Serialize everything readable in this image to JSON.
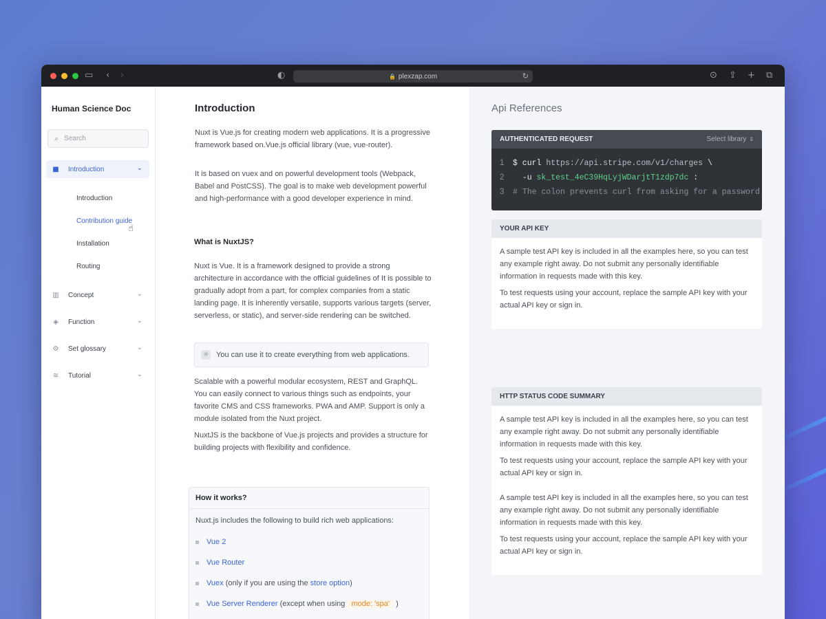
{
  "browser": {
    "url": "plexzap.com",
    "traffic_colors": [
      "#ff5f57",
      "#febc2e",
      "#28c840"
    ]
  },
  "sidebar": {
    "brand": "Human Science Doc",
    "search_placeholder": "Search",
    "sections": [
      {
        "label": "Introduction",
        "icon": "briefcase-icon",
        "expanded": true,
        "children": [
          "Introduction",
          "Contribution guide",
          "Installation",
          "Routing"
        ]
      },
      {
        "label": "Concept",
        "icon": "bar-chart-icon"
      },
      {
        "label": "Function",
        "icon": "layers-icon"
      },
      {
        "label": "Set glossary",
        "icon": "gear-icon"
      },
      {
        "label": "Tutorial",
        "icon": "stack-icon"
      }
    ],
    "active_child": "Contribution guide"
  },
  "main": {
    "title": "Introduction",
    "intro_p1": "Nuxt is Vue.js for creating modern web applications. It is a progressive framework based on.Vue.js official library (vue, vue-router).",
    "intro_p2": "It is based on vuex and on powerful development tools (Webpack, Babel and PostCSS). The goal is to make web development powerful and high-performance with a good developer experience in mind.",
    "what_title": "What is NuxtJS?",
    "what_p1": "Nuxt is Vue. It is a framework designed to provide a strong architecture in accordance with the official guidelines of It is possible to gradually adopt from a part, for complex companies from a static landing page. It is inherently versatile, supports various targets (server, serverless, or static), and server-side rendering can be switched.",
    "tip": "You can use it to create everything from web applications.",
    "scal_p1": "Scalable with a powerful modular ecosystem, REST and GraphQL. You can easily connect to various things such as endpoints, your favorite CMS and CSS frameworks. PWA and AMP. Support is only a module isolated from the Nuxt project.",
    "scal_p2": "NuxtJS is the backbone of Vue.js projects and provides a structure for building projects with flexibility and confidence.",
    "how": {
      "title": "How it works?",
      "intro": "Nuxt.js includes the following to build rich web applications:",
      "items": [
        {
          "link": "Vue 2",
          "rest": ""
        },
        {
          "link": "Vue Router",
          "rest": ""
        },
        {
          "link": "Vuex",
          "rest_before": " (only if you are using the ",
          "link2": "store option",
          "rest_after": ")"
        },
        {
          "link": "Vue Server Renderer",
          "rest_before": " (except when using ",
          "code": "mode: 'spa'",
          "rest_after": " )"
        }
      ]
    }
  },
  "right": {
    "title": "Api References",
    "request": {
      "header": "AUTHENTICATED REQUEST",
      "select_label": "Select library",
      "lines": [
        {
          "num": "1",
          "prefix": "$ curl ",
          "url": "https://api.stripe.com/v1/charges",
          "suffix": " \\"
        },
        {
          "num": "2",
          "prefix": "  -u ",
          "key": "sk_test_4eC39HqLyjWDarjtT1zdp7dc",
          "suffix": " :"
        },
        {
          "num": "3",
          "comment": "# The colon prevents curl from asking for a password."
        }
      ]
    },
    "api_key": {
      "header": "YOUR API KEY",
      "p1": "A sample test API key is included in all the examples here, so you can test any example right away. Do not submit any personally identifiable information in requests made with this key.",
      "p2": "To test requests using your account, replace the sample API key with your actual API key or sign in."
    },
    "status": {
      "header": "HTTP STATUS CODE SUMMARY",
      "p1": "A sample test API key is included in all the examples here, so you can test any example right away. Do not submit any personally identifiable information in requests made with this key.",
      "p2": "To test requests using your account, replace the sample API key with your actual API key or sign in.",
      "p3": "A sample test API key is included in all the examples here, so you can test any example right away. Do not submit any personally identifiable information in requests made with this key.",
      "p4": "To test requests using your account, replace the sample API key with your actual API key or sign in."
    }
  }
}
